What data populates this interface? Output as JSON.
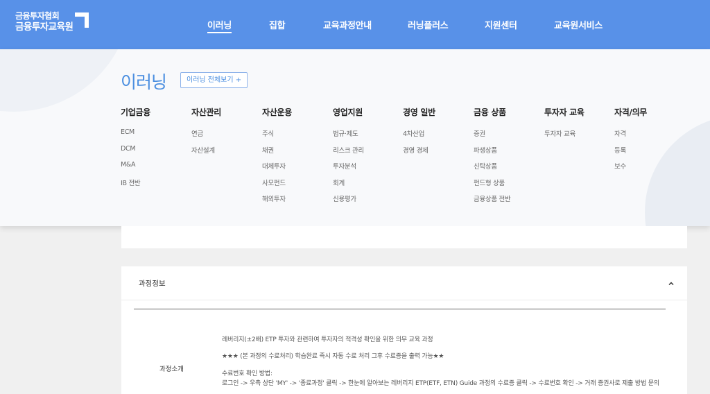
{
  "header": {
    "logo_line1": "금융투자협회",
    "logo_line2": "금융투자교육원",
    "nav": [
      {
        "label": "이러닝",
        "active": true
      },
      {
        "label": "집합"
      },
      {
        "label": "교육과정안내"
      },
      {
        "label": "러닝플러스"
      },
      {
        "label": "지원센터"
      },
      {
        "label": "교육원서비스"
      }
    ]
  },
  "mega": {
    "title": "이러닝",
    "all_button": "이러닝 전체보기 +",
    "columns": [
      {
        "heading": "기업금융",
        "items": [
          "ECM",
          "DCM",
          "M&A",
          "IB 전반"
        ]
      },
      {
        "heading": "자산관리",
        "items": [
          "연금",
          "자산설계"
        ]
      },
      {
        "heading": "자산운용",
        "items": [
          "주식",
          "채권",
          "대체투자",
          "사모펀드",
          "해외투자"
        ]
      },
      {
        "heading": "영업지원",
        "items": [
          "법규·제도",
          "리스크 관리",
          "투자분석",
          "회계",
          "신용평가"
        ]
      },
      {
        "heading": "경영 일반",
        "items": [
          "4차산업",
          "경영 경제"
        ]
      },
      {
        "heading": "금융 상품",
        "items": [
          "증권",
          "파생상품",
          "신탁상품",
          "펀드형 상품",
          "금융상품 전반"
        ]
      },
      {
        "heading": "투자자 교육",
        "items": [
          "투자자 교육"
        ]
      },
      {
        "heading": "자격/의무",
        "items": [
          "자격",
          "등록",
          "보수"
        ]
      }
    ]
  },
  "course": {
    "section_title": "과정정보",
    "row_label": "과정소개",
    "lines": [
      "레버리지(±2배) ETP 투자와 관련하여 투자자의 적격성 확인을 위한 의무 교육 과정",
      "★★★ (본 과정의 수료처리) 학습완료 즉시 자동 수료 처리 그후 수료증을 출력 가능★★",
      "수료번호 확인 방법:",
      "로그인 -> 우측 상단 'MY' -> '종료과정' 클릭 -> 한눈에 알아보는 레버리지 ETP(ETF, ETN) Guide 과정의 수료증 클릭 -> 수료번호 확인 -> 거래 증권사로 제출 방법 문의"
    ]
  },
  "colors": {
    "header_bg": "#5891e8",
    "accent": "#4a8ee0",
    "page_bg": "#f0f0f0"
  }
}
